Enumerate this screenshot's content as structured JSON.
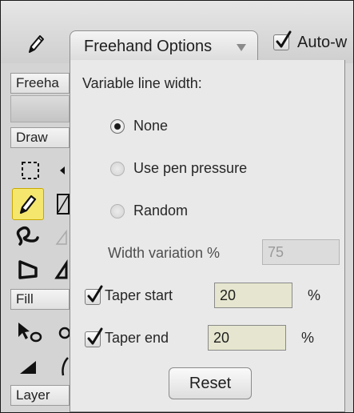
{
  "toolbar": {
    "dropdown_label": "Freehand Options",
    "auto_label": "Auto-w",
    "auto_checked": true
  },
  "left_panel": {
    "freehand_label": "Freeha",
    "draw_label": "Draw",
    "fill_label": "Fill",
    "layer_label": "Layer"
  },
  "options": {
    "heading": "Variable line width:",
    "line_width_modes": [
      {
        "label": "None",
        "selected": true
      },
      {
        "label": "Use pen pressure",
        "selected": false
      },
      {
        "label": "Random",
        "selected": false
      }
    ],
    "width_variation_label": "Width variation %",
    "width_variation_value": "75",
    "taper_start": {
      "label": "Taper start",
      "checked": true,
      "value": "20",
      "unit": "%"
    },
    "taper_end": {
      "label": "Taper end",
      "checked": true,
      "value": "20",
      "unit": "%"
    },
    "reset_label": "Reset"
  },
  "icons": [
    "pencil-icon",
    "dropdown-arrow-icon",
    "checkmark-icon",
    "marquee-select-icon",
    "freehand-icon",
    "shape-icon",
    "curve-icon",
    "lasso-icon",
    "wedge-icon"
  ],
  "colors": {
    "active_tool": "#f5e76e",
    "field_bg": "#e6e6d0",
    "panel_bg": "#e9e9e9"
  }
}
